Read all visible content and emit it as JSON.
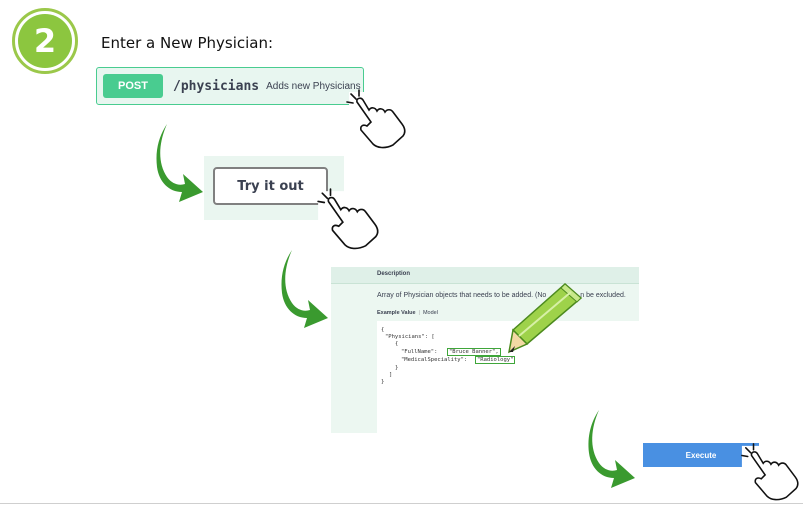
{
  "step": {
    "number": "2",
    "title": "Enter a New Physician:"
  },
  "endpoint": {
    "method": "POST",
    "path": "/physicians",
    "summary": "Adds new Physicians"
  },
  "try_button": {
    "label": "Try it out"
  },
  "request_body": {
    "description_label": "Description",
    "description_text": "Array of Physician objects that needs to be added. (No",
    "description_text_end": "n be excluded.",
    "tabs": [
      "Example Value",
      "Model"
    ],
    "code": {
      "open_brace": "{",
      "physicians_key": "\"Physicians\": [",
      "item_open": "{",
      "fullname_key": "\"FullName\":",
      "fullname_value": "\"Bruce Banner\",",
      "specialty_key": "\"MedicalSpeciality\":",
      "specialty_value": "\"Radiology\"",
      "item_close": "}",
      "array_close": "]",
      "close_brace": "}"
    }
  },
  "execute_button": {
    "label": "Execute"
  },
  "colors": {
    "badge_green": "#8cc63f",
    "post_green": "#49cc90",
    "arrow_green": "#3a9a2f",
    "execute_blue": "#4990e2"
  },
  "icons": [
    "hand-pointer-icon",
    "curved-arrow-icon",
    "pencil-icon"
  ]
}
